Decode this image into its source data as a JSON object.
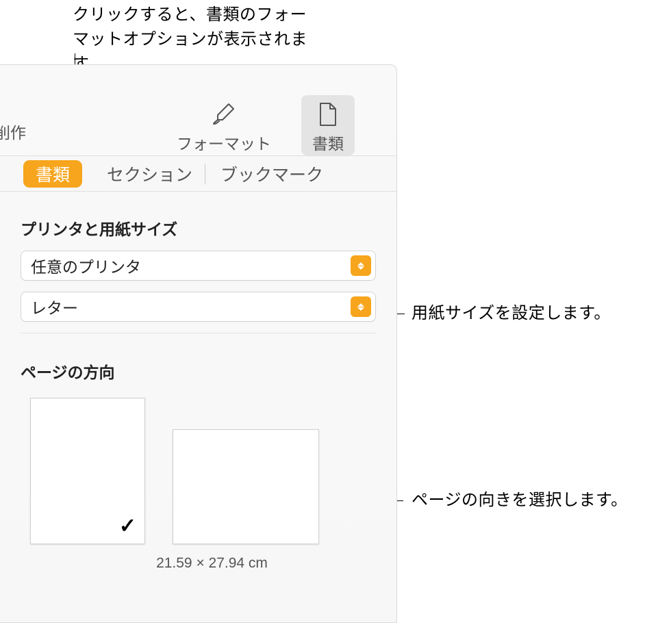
{
  "callouts": {
    "top": "クリックすると、書類のフォーマットオプションが表示されます。",
    "paper": "用紙サイズを設定します。",
    "orient": "ページの向きを選択します。"
  },
  "toolbar": {
    "left_partial": "削作",
    "format": "フォーマット",
    "document": "書類"
  },
  "subtabs": {
    "document": "書類",
    "section": "セクション",
    "bookmark": "ブックマーク"
  },
  "sections": {
    "printer_paper_title": "プリンタと用紙サイズ",
    "printer_value": "任意のプリンタ",
    "paper_value": "レター",
    "orientation_title": "ページの方向",
    "dimensions": "21.59 × 27.94 cm"
  }
}
